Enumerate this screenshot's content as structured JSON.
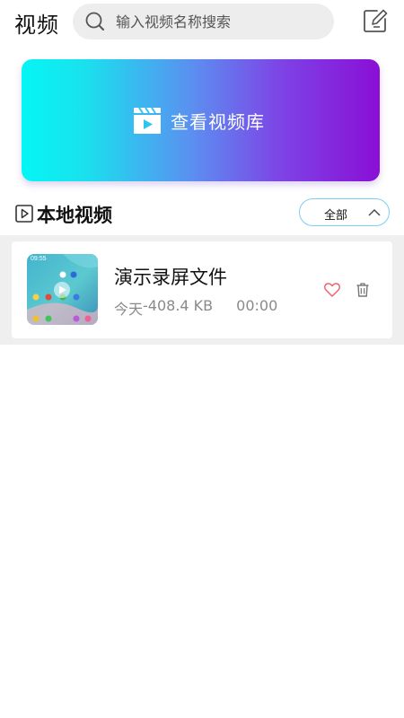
{
  "header": {
    "title": "视频",
    "search_placeholder": "输入视频名称搜索",
    "icons": {
      "search": "search-icon",
      "edit": "edit-icon"
    }
  },
  "banner": {
    "label": "查看视频库",
    "icon": "video-library-icon",
    "gradient_colors": [
      "#05f6f4",
      "#5c8ef0",
      "#8a0fd6"
    ]
  },
  "local_section": {
    "title": "本地视频",
    "icon": "play-box-icon",
    "filter": {
      "selected": "全部",
      "icon": "chevron-up-icon"
    }
  },
  "videos": [
    {
      "title": "演示录屏文件",
      "date": "今天",
      "size": "-408.4 KB",
      "duration": "00:00",
      "thumb_time": "09:55",
      "actions": {
        "favorite": "heart-icon",
        "delete": "trash-icon"
      }
    }
  ],
  "colors": {
    "filter_border": "#7ecdf2",
    "heart": "#f25a6a",
    "meta_text": "#8a8a8a",
    "list_background": "#efefef"
  }
}
